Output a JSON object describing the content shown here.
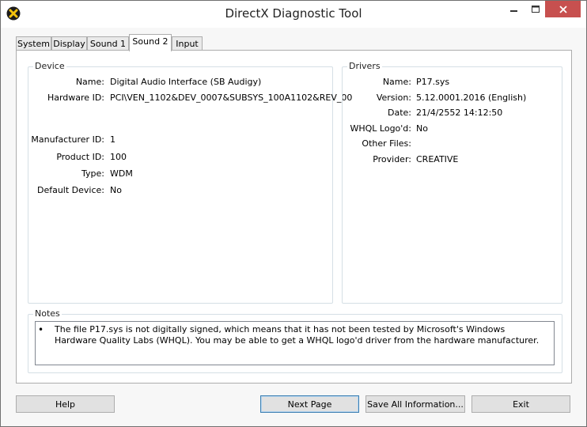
{
  "window": {
    "title": "DirectX Diagnostic Tool"
  },
  "tabs": [
    {
      "label": "System"
    },
    {
      "label": "Display"
    },
    {
      "label": "Sound 1"
    },
    {
      "label": "Sound 2"
    },
    {
      "label": "Input"
    }
  ],
  "active_tab": "Sound 2",
  "device": {
    "heading": "Device",
    "name_label": "Name:",
    "name": "Digital Audio Interface (SB Audigy)",
    "hardware_id_label": "Hardware ID:",
    "hardware_id": "PCI\\VEN_1102&DEV_0007&SUBSYS_100A1102&REV_00",
    "manufacturer_id_label": "Manufacturer ID:",
    "manufacturer_id": "1",
    "product_id_label": "Product ID:",
    "product_id": "100",
    "type_label": "Type:",
    "type": "WDM",
    "default_device_label": "Default Device:",
    "default_device": "No"
  },
  "drivers": {
    "heading": "Drivers",
    "name_label": "Name:",
    "name": "P17.sys",
    "version_label": "Version:",
    "version": "5.12.0001.2016 (English)",
    "date_label": "Date:",
    "date": "21/4/2552 14:12:50",
    "whql_label": "WHQL Logo'd:",
    "whql": "No",
    "other_files_label": "Other Files:",
    "other_files": "",
    "provider_label": "Provider:",
    "provider": "CREATIVE"
  },
  "notes": {
    "heading": "Notes",
    "bullet": "•",
    "text": "The file P17.sys is not digitally signed, which means that it has not been tested by Microsoft's Windows Hardware Quality Labs (WHQL).  You may be able to get a WHQL logo'd driver from the hardware manufacturer."
  },
  "buttons": {
    "help": "Help",
    "next_page": "Next Page",
    "save_all": "Save All Information...",
    "exit": "Exit"
  },
  "colors": {
    "close_button": "#c7504f",
    "accent_border": "#3c7fb1"
  }
}
